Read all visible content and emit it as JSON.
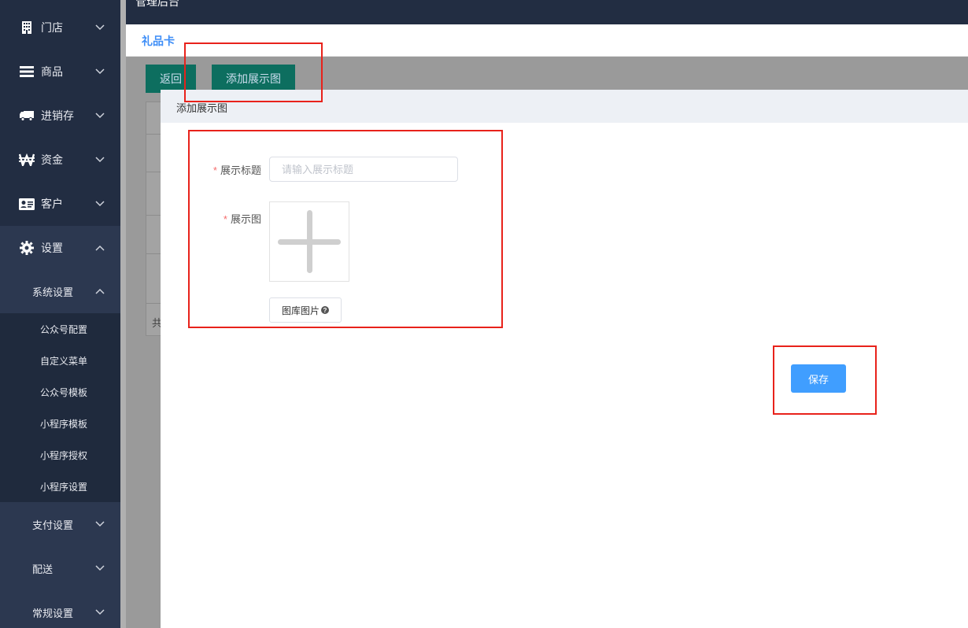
{
  "sidebar": {
    "items": [
      {
        "label": "门店",
        "icon": "building-icon"
      },
      {
        "label": "商品",
        "icon": "list-icon"
      },
      {
        "label": "进销存",
        "icon": "truck-icon"
      },
      {
        "label": "资金",
        "icon": "won-icon"
      },
      {
        "label": "客户",
        "icon": "id-card-icon"
      },
      {
        "label": "设置",
        "icon": "gear-icon"
      }
    ],
    "system_settings": "系统设置",
    "leaves": [
      "公众号配置",
      "自定义菜单",
      "公众号模板",
      "小程序模板",
      "小程序授权",
      "小程序设置"
    ],
    "lower": [
      "支付设置",
      "配送",
      "常规设置"
    ]
  },
  "header": {
    "title": "管理后台",
    "breadcrumb": "礼品卡"
  },
  "toolbar": {
    "back_label": "返回",
    "add_label": "添加展示图"
  },
  "table": {
    "footer_text": "共"
  },
  "dialog": {
    "title": "添加展示图",
    "title_label": "展示标题",
    "title_placeholder": "请输入展示标题",
    "image_label": "展示图",
    "library_label": "图库图片",
    "save_label": "保存"
  },
  "colors": {
    "sidebar": "#222d42",
    "accent": "#409eff",
    "green": "#0d6e5f",
    "annotation": "#e8221b"
  }
}
